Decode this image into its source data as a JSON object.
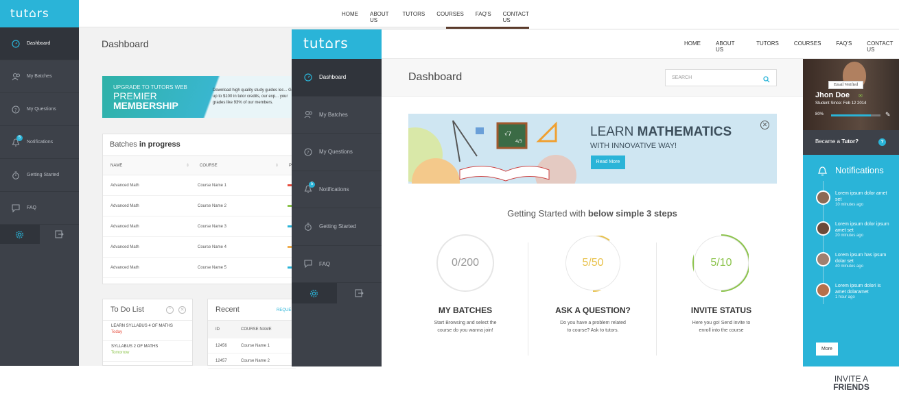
{
  "back": {
    "logo": "tut⌂rs web",
    "nav": [
      "HOME",
      "ABOUT US",
      "TUTORS",
      "COURSES",
      "FAQ'S",
      "CONTACT US"
    ],
    "sidebar": [
      {
        "label": "Dashboard",
        "icon": "dashboard-icon",
        "active": true
      },
      {
        "label": "My Batches",
        "icon": "users-icon"
      },
      {
        "label": "My Questions",
        "icon": "question-icon"
      },
      {
        "label": "Notifications",
        "icon": "bell-icon",
        "badge": "5"
      },
      {
        "label": "Getting Started",
        "icon": "stopwatch-icon"
      },
      {
        "label": "FAQ",
        "icon": "chat-icon"
      }
    ],
    "title": "Dashboard",
    "banner": {
      "line1": "UPGRADE TO TUTORS WEB",
      "line2": "PREMIER",
      "line3": "MEMBERSHIP",
      "text": "Download high quality study guides lec... Get up to $100 in tutor credits, our exp... your grades like 93% of our members."
    },
    "batches": {
      "title_a": "Batches ",
      "title_b": "in progress",
      "col_name": "NAME",
      "col_course": "COURSE",
      "col_pr": "PR",
      "rows": [
        {
          "name": "Advanced Math",
          "course": "Course Name 1",
          "color": "#e74c3c"
        },
        {
          "name": "Advanced Math",
          "course": "Course Name 2",
          "color": "#8bc34a"
        },
        {
          "name": "Advanced Math",
          "course": "Course Name 3",
          "color": "#2ab4d8"
        },
        {
          "name": "Advanced Math",
          "course": "Course Name 4",
          "color": "#f0ad4e"
        },
        {
          "name": "Advanced Math",
          "course": "Course Name 5",
          "color": "#2ab4d8"
        }
      ]
    },
    "todo": {
      "title": "To Do List",
      "items": [
        {
          "text": "LEARN SYLLABUS 4 OF MATHS",
          "due": "Today",
          "color": "#e74c3c"
        },
        {
          "text": "SYLLABUS 2 OF MATHS",
          "due": "Tomorrow",
          "color": "#8bc34a"
        }
      ]
    },
    "recent": {
      "title": "Recent",
      "tab": "REQUE",
      "col_id": "ID",
      "col_course": "COURSE NAME",
      "rows": [
        {
          "id": "12456",
          "course": "Course Name 1"
        },
        {
          "id": "12457",
          "course": "Course Name 2"
        }
      ]
    }
  },
  "front": {
    "logo": "tut⌂rs web",
    "nav": [
      "HOME",
      "ABOUT US",
      "TUTORS",
      "COURSES",
      "FAQ'S",
      "CONTACT US"
    ],
    "sidebar": [
      {
        "label": "Dashboard",
        "icon": "dashboard-icon",
        "active": true
      },
      {
        "label": "My Batches",
        "icon": "users-icon"
      },
      {
        "label": "My Questions",
        "icon": "question-icon"
      },
      {
        "label": "Notifications",
        "icon": "bell-icon",
        "badge": "5"
      },
      {
        "label": "Getting Started",
        "icon": "stopwatch-icon"
      },
      {
        "label": "FAQ",
        "icon": "chat-icon"
      }
    ],
    "title": "Dashboard",
    "search_placeholder": "SEARCH",
    "banner": {
      "h1_a": "LEARN ",
      "h1_b": "MATHEMATICS",
      "h2": "WITH INNOVATIVE WAY!",
      "button": "Read More",
      "close": "✕"
    },
    "steps_title_a": "Getting Started with ",
    "steps_title_b": "below simple 3 steps",
    "steps": [
      {
        "value": "0/200",
        "name": "MY BATCHES",
        "desc": "Start Browsing and select the course do you wanna join!",
        "color": "#cccccc",
        "progress": 0.0
      },
      {
        "value": "5/50",
        "name": "ASK A QUESTION?",
        "desc": "Do you have a problem related to course? Ask to tutors.",
        "color": "#e8c14a",
        "progress": 0.1
      },
      {
        "value": "5/10",
        "name": "INVITE STATUS",
        "desc": "Here you go! Send invite to enroll into the course",
        "color": "#8bc34a",
        "progress": 0.5
      }
    ],
    "profile": {
      "verified": "Email Verified",
      "name": "Jhon Doe",
      "since": "Student Since: Feb 12 2014",
      "pct": "80%",
      "progress": 0.8,
      "tutor_a": "Became a ",
      "tutor_b": "Tutor?",
      "tutor_q": "?"
    },
    "notifications": {
      "title": "Notifications",
      "items": [
        {
          "text": "Lorem ipsum dolor amet set",
          "time": "10 minutes ago"
        },
        {
          "text": "Lorem ipsum dolor ipsum amet set",
          "time": "20 minutes ago"
        },
        {
          "text": "Lorem ipsum has ipsum dolar set",
          "time": "40 minutes ago"
        },
        {
          "text": "Lorem ipsum dolori is amet dolaramet",
          "time": "1 hour ago"
        }
      ],
      "more": "More"
    },
    "invite": {
      "line1": "INVITE A",
      "line2": "FRIENDS"
    }
  }
}
